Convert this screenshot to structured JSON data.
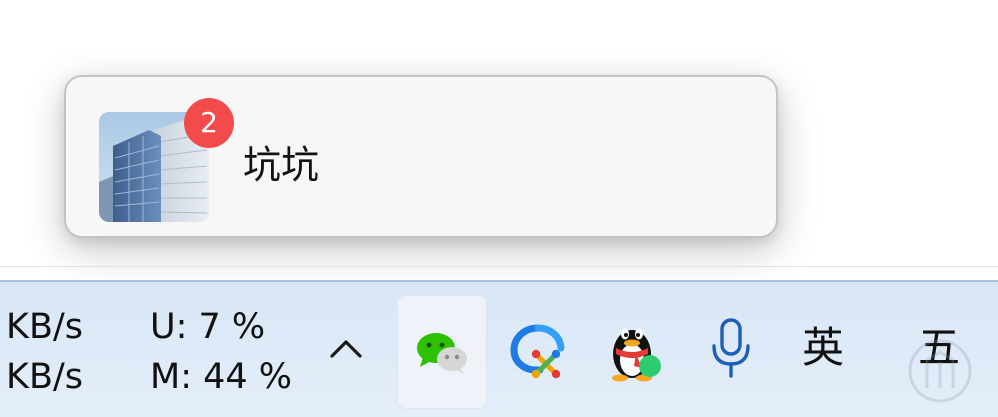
{
  "notification": {
    "contact_name": "坑坑",
    "unread_count": "2",
    "avatar_icon": "building-photo-avatar"
  },
  "taskbar": {
    "network_monitor": {
      "upload_speed": "KB/s",
      "download_speed": "KB/s",
      "cpu_usage": "U: 7 %",
      "memory_usage": "M: 44 %"
    },
    "show_hidden_icon": "chevron-up-icon",
    "tray_icons": [
      "wechat-icon",
      "dingtalk-icon",
      "qq-icon",
      "microphone-icon"
    ],
    "input_language": "英",
    "input_method": "五"
  },
  "colors": {
    "badge": "#f34b4b",
    "taskbar_bg": "#dce8f6",
    "popup_bg": "#f7f7f7",
    "wechat_green": "#2dc100",
    "mic_blue": "#1d5fb8"
  }
}
